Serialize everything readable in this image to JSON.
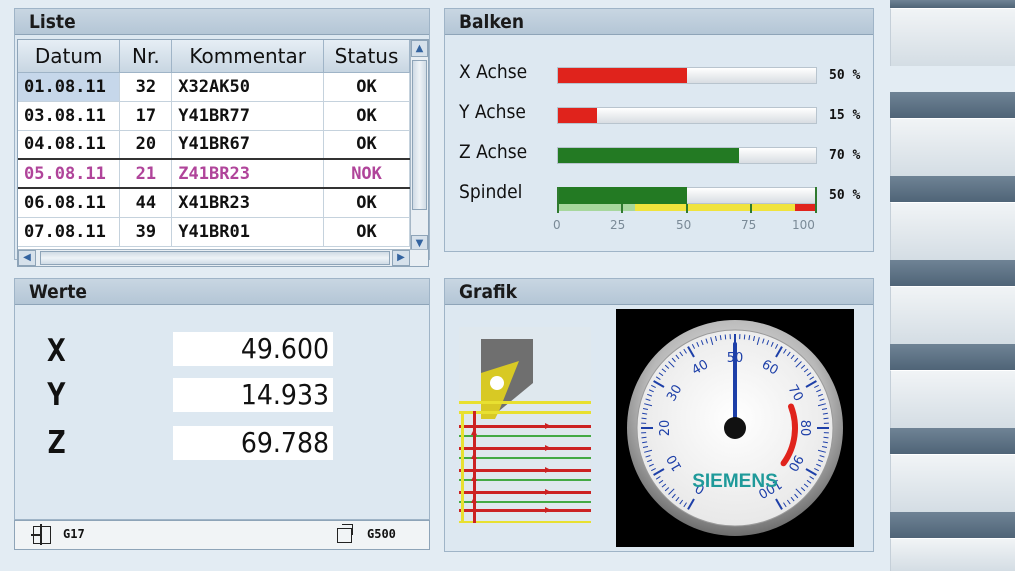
{
  "liste": {
    "title": "Liste",
    "columns": [
      "Datum",
      "Nr.",
      "Kommentar",
      "Status"
    ],
    "rows": [
      {
        "datum": "01.08.11",
        "nr": "32",
        "kommentar": "X32AK50",
        "status": "OK"
      },
      {
        "datum": "03.08.11",
        "nr": "17",
        "kommentar": "Y41BR77",
        "status": "OK"
      },
      {
        "datum": "04.08.11",
        "nr": "20",
        "kommentar": "Y41BR67",
        "status": "OK"
      },
      {
        "datum": "05.08.11",
        "nr": "21",
        "kommentar": "Z41BR23",
        "status": "NOK"
      },
      {
        "datum": "06.08.11",
        "nr": "44",
        "kommentar": "X41BR23",
        "status": "OK"
      },
      {
        "datum": "07.08.11",
        "nr": "39",
        "kommentar": "Y41BR01",
        "status": "OK"
      }
    ]
  },
  "balken": {
    "title": "Balken",
    "bars": [
      {
        "label": "X Achse",
        "percent": 50,
        "percent_text": "50 %",
        "color": "#e0231c"
      },
      {
        "label": "Y Achse",
        "percent": 15,
        "percent_text": "15 %",
        "color": "#e0231c"
      },
      {
        "label": "Z Achse",
        "percent": 70,
        "percent_text": "70 %",
        "color": "#237a23"
      },
      {
        "label": "Spindel",
        "percent": 50,
        "percent_text": "50 %",
        "color": "#237a23"
      }
    ],
    "scale": [
      "0",
      "25",
      "50",
      "75",
      "100"
    ]
  },
  "werte": {
    "title": "Werte",
    "values": [
      {
        "axis": "X",
        "value": "49.600"
      },
      {
        "axis": "Y",
        "value": "14.933"
      },
      {
        "axis": "Z",
        "value": "69.788"
      }
    ]
  },
  "statusbar": {
    "left_label": "G17",
    "right_label": "G500"
  },
  "grafik": {
    "title": "Grafik",
    "gauge": {
      "brand": "SIEMENS",
      "value": 50,
      "ticks": [
        "0",
        "10",
        "20",
        "30",
        "40",
        "50",
        "60",
        "70",
        "80",
        "90",
        "100"
      ]
    }
  }
}
